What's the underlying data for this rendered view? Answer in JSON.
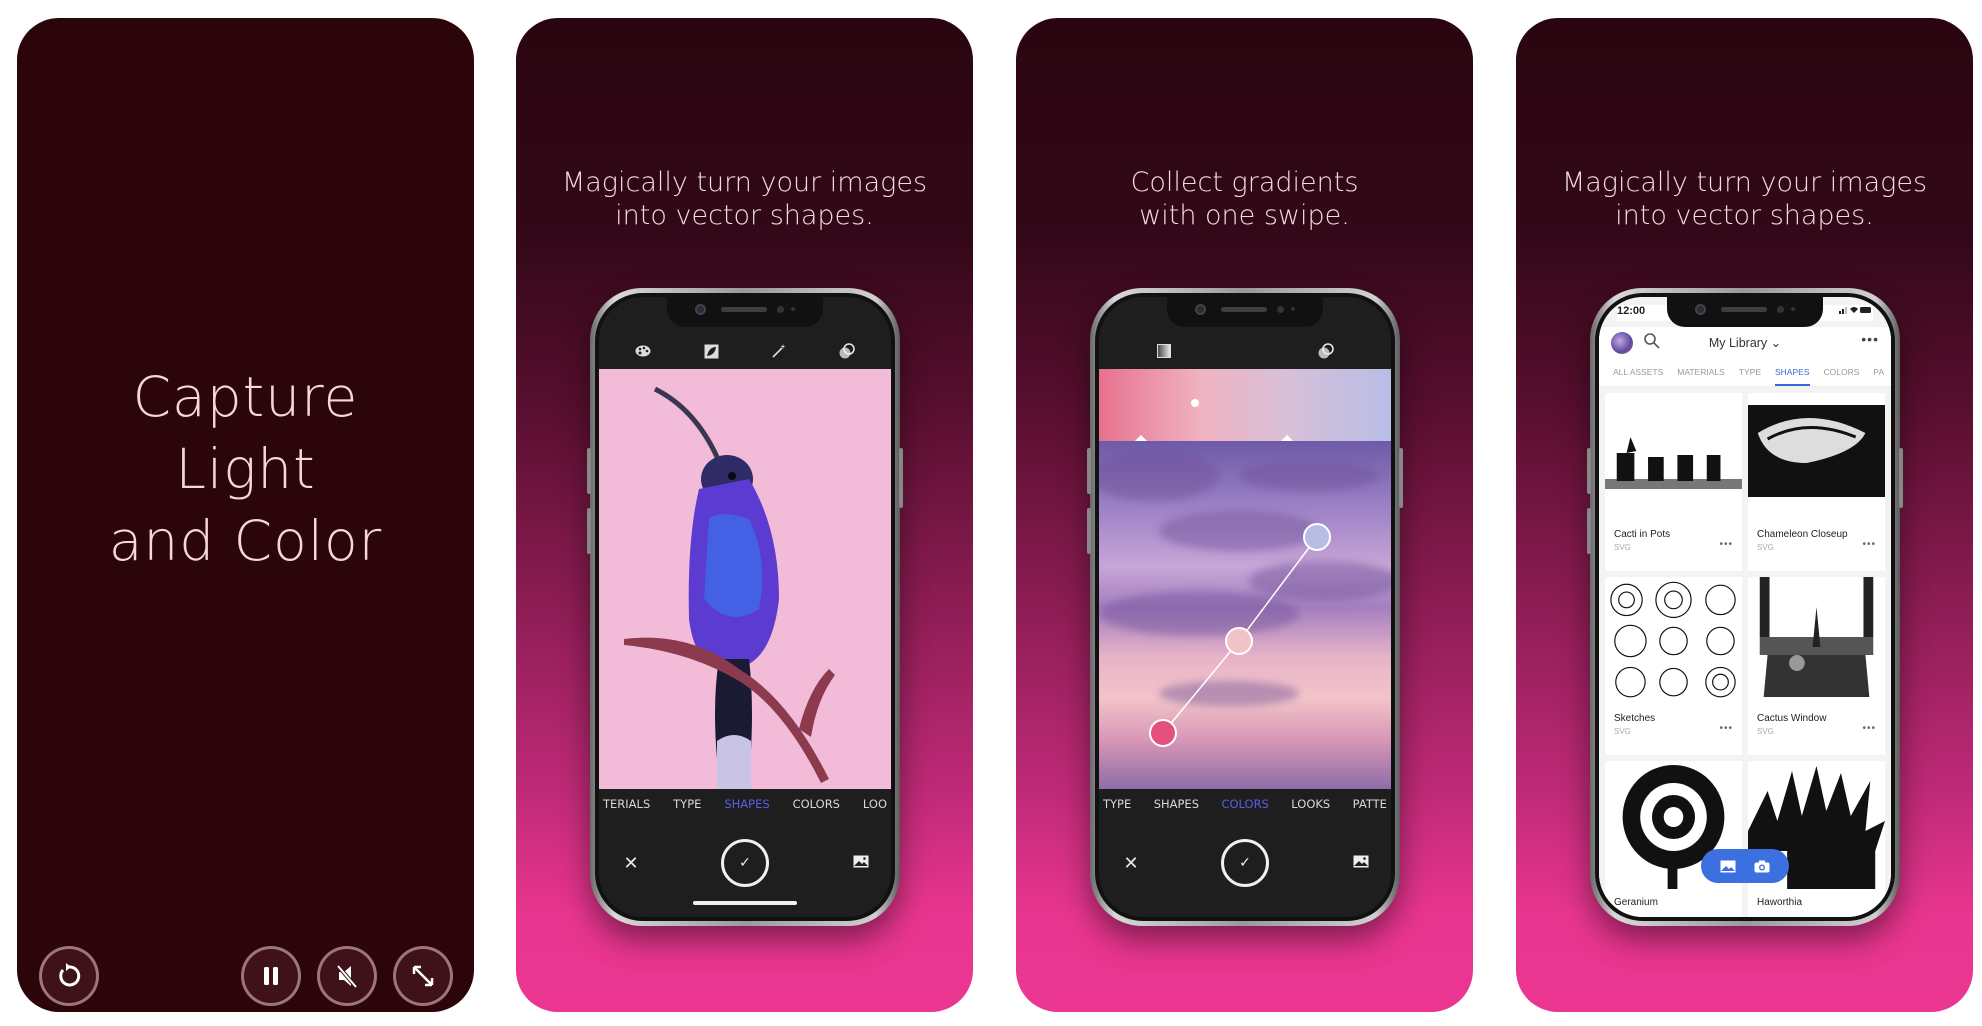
{
  "cards": [
    {
      "title_lines": [
        "Capture",
        "Light",
        "and Color"
      ],
      "controls": {
        "replay": "replay-icon",
        "pause": "pause-icon",
        "mute": "mute-icon",
        "expand": "expand-icon"
      }
    },
    {
      "caption_lines": [
        "Magically turn your images",
        "into vector shapes."
      ],
      "toolbar_icons": [
        "palette-icon",
        "shape-capture-icon",
        "magic-wand-icon",
        "blend-icon"
      ],
      "tabs": [
        "TERIALS",
        "TYPE",
        "SHAPES",
        "COLORS",
        "LOO"
      ],
      "active_tab": "SHAPES",
      "bottom": {
        "close": "✕",
        "confirm": "✓"
      }
    },
    {
      "caption_lines": [
        "Collect gradients",
        "with one swipe."
      ],
      "toolbar_icons": [
        "gradient-icon",
        "blend-icon"
      ],
      "tabs": [
        "TYPE",
        "SHAPES",
        "COLORS",
        "LOOKS",
        "PATTE"
      ],
      "active_tab": "COLORS",
      "bottom": {
        "close": "✕",
        "confirm": "✓"
      }
    },
    {
      "caption_lines": [
        "Magically turn your images",
        "into vector shapes."
      ],
      "status_time": "12:00",
      "library_title": "My Library ⌄",
      "more": "•••",
      "tabs": [
        "ALL ASSETS",
        "MATERIALS",
        "TYPE",
        "SHAPES",
        "COLORS",
        "PA"
      ],
      "active_tab": "SHAPES",
      "assets": [
        {
          "name": "Cacti in Pots",
          "type": "SVG"
        },
        {
          "name": "Chameleon Closeup",
          "type": "SVG"
        },
        {
          "name": "Sketches",
          "type": "SVG"
        },
        {
          "name": "Cactus Window",
          "type": "SVG"
        },
        {
          "name": "Geranium",
          "type": ""
        },
        {
          "name": "Haworthia",
          "type": ""
        }
      ],
      "tile_more": "•••"
    }
  ],
  "colors": {
    "card_dark": "#2b0509",
    "card_gradient_bottom": "#ea3690",
    "active_tab_dark": "#5a5ee6",
    "active_tab_light": "#3a66d6",
    "fab": "#3c6fe0",
    "bird_bg": "#f2bcd9"
  }
}
